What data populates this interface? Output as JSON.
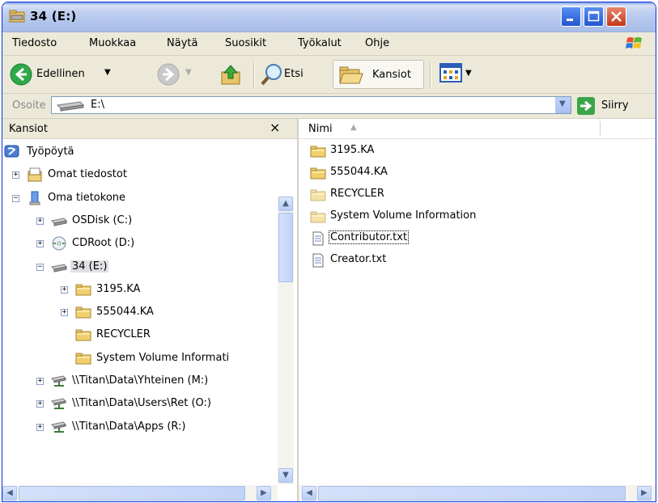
{
  "window": {
    "title": "34 (E:)"
  },
  "menu": [
    "Tiedosto",
    "Muokkaa",
    "Näytä",
    "Suosikit",
    "Työkalut",
    "Ohje"
  ],
  "toolbar": {
    "back_label": "Edellinen",
    "search_label": "Etsi",
    "folders_label": "Kansiot"
  },
  "address": {
    "label": "Osoite",
    "value": "E:\\",
    "go_label": "Siirry"
  },
  "folders_pane": {
    "title": "Kansiot",
    "close": "×",
    "tree": [
      {
        "label": "Työpöytä",
        "icon": "desktop-icon",
        "expander": "",
        "level": 0
      },
      {
        "label": "Omat tiedostot",
        "icon": "my-documents-icon",
        "expander": "+",
        "level": 1
      },
      {
        "label": "Oma tietokone",
        "icon": "my-computer-icon",
        "expander": "−",
        "level": 1
      },
      {
        "label": "OSDisk (C:)",
        "icon": "hard-drive-icon",
        "expander": "+",
        "level": 2
      },
      {
        "label": "CDRoot (D:)",
        "icon": "cd-drive-icon",
        "expander": "+",
        "level": 2
      },
      {
        "label": "34 (E:)",
        "icon": "removable-drive-icon",
        "expander": "−",
        "level": 2,
        "selected": true
      },
      {
        "label": "3195.KA",
        "icon": "folder-icon",
        "expander": "+",
        "level": 3
      },
      {
        "label": "555044.KA",
        "icon": "folder-icon",
        "expander": "+",
        "level": 3
      },
      {
        "label": "RECYCLER",
        "icon": "folder-icon",
        "expander": "",
        "level": 3
      },
      {
        "label": "System Volume Informati",
        "icon": "folder-icon",
        "expander": "",
        "level": 3
      },
      {
        "label": "\\\\Titan\\Data\\Yhteinen (M:)",
        "icon": "network-drive-icon",
        "expander": "+",
        "level": 2
      },
      {
        "label": "\\\\Titan\\Data\\Users\\Ret (O:)",
        "icon": "network-drive-icon",
        "expander": "+",
        "level": 2
      },
      {
        "label": "\\\\Titan\\Data\\Apps (R:)",
        "icon": "network-drive-icon",
        "expander": "+",
        "level": 2
      }
    ]
  },
  "file_list": {
    "column_name": "Nimi",
    "sort_indicator": "▲",
    "items": [
      {
        "name": "3195.KA",
        "icon": "folder-icon",
        "type": "folder"
      },
      {
        "name": "555044.KA",
        "icon": "folder-icon",
        "type": "folder"
      },
      {
        "name": "RECYCLER",
        "icon": "folder-icon",
        "type": "folder-system"
      },
      {
        "name": "System Volume Information",
        "icon": "folder-icon",
        "type": "folder-system"
      },
      {
        "name": "Contributor.txt",
        "icon": "text-file-icon",
        "type": "file",
        "focused": true
      },
      {
        "name": "Creator.txt",
        "icon": "text-file-icon",
        "type": "file"
      }
    ]
  },
  "colors": {
    "title_gradient_top": "#7e9fe3",
    "close_button": "#c4381b",
    "chrome": "#ece9d8",
    "border_blue": "#0831d9"
  }
}
